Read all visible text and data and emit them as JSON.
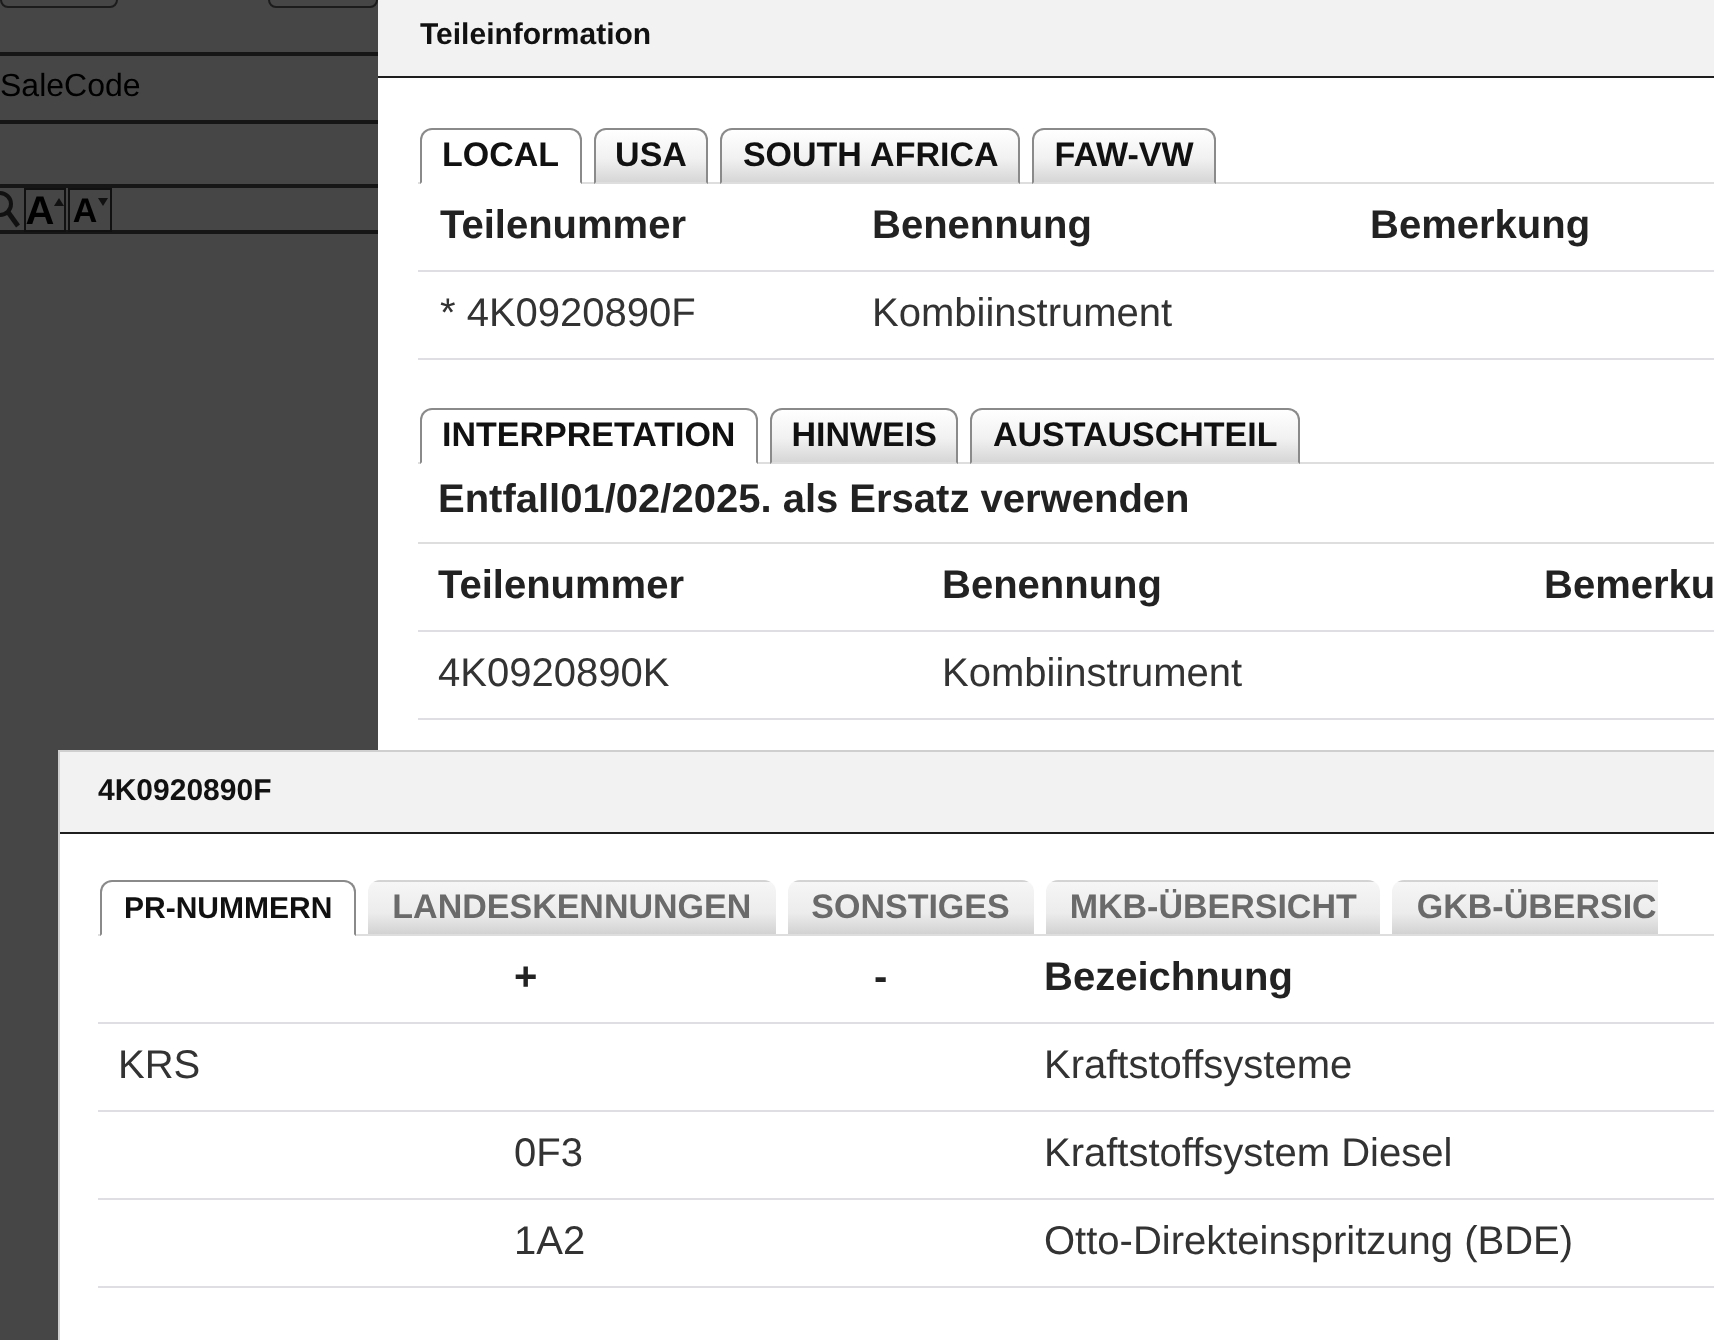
{
  "background_page": {
    "column_header": "SaleCode",
    "font_buttons": [
      {
        "label": "A",
        "kind": "increase"
      },
      {
        "label": "A",
        "kind": "decrease"
      }
    ]
  },
  "dialogs": [
    {
      "title": "Teileinformation",
      "sections": [
        {
          "tabs": [
            {
              "label": "LOCAL",
              "selected": true
            },
            {
              "label": "USA",
              "selected": false
            },
            {
              "label": "SOUTH AFRICA",
              "selected": false
            },
            {
              "label": "FAW-VW",
              "selected": false
            }
          ],
          "table": {
            "columns": [
              "Teilenummer",
              "Benennung",
              "Bemerkung"
            ],
            "rows": [
              [
                "* 4K0920890F",
                "Kombiinstrument"
              ]
            ]
          }
        },
        {
          "tabs": [
            {
              "label": "INTERPRETATION",
              "selected": true
            },
            {
              "label": "HINWEIS",
              "selected": false
            },
            {
              "label": "AUSTAUSCHTEIL",
              "selected": false
            }
          ],
          "note": "Entfall01/02/2025. als Ersatz verwenden",
          "table": {
            "columns": [
              "Teilenummer",
              "Benennung",
              "Bemerku"
            ],
            "rows": [
              [
                "4K0920890K",
                "Kombiinstrument"
              ]
            ]
          }
        }
      ]
    },
    {
      "title": "4K0920890F",
      "sections": [
        {
          "tabs": [
            {
              "label": "PR-NUMMERN",
              "selected": true
            },
            {
              "label": "LANDESKENNUNGEN",
              "selected": false
            },
            {
              "label": "SONSTIGES",
              "selected": false
            },
            {
              "label": "MKB-ÜBERSICHT",
              "selected": false
            },
            {
              "label": "GKB-ÜBERSIC",
              "selected": false
            }
          ],
          "table": {
            "columns": [
              null,
              "+",
              "-",
              "Bezeichnung"
            ],
            "rows": [
              [
                "KRS",
                null,
                null,
                "Kraftstoffsysteme"
              ],
              [
                null,
                "0F3",
                null,
                "Kraftstoffsystem Diesel"
              ],
              [
                null,
                "1A2",
                null,
                "Otto-Direkteinspritzung (BDE)"
              ]
            ]
          }
        }
      ]
    }
  ]
}
